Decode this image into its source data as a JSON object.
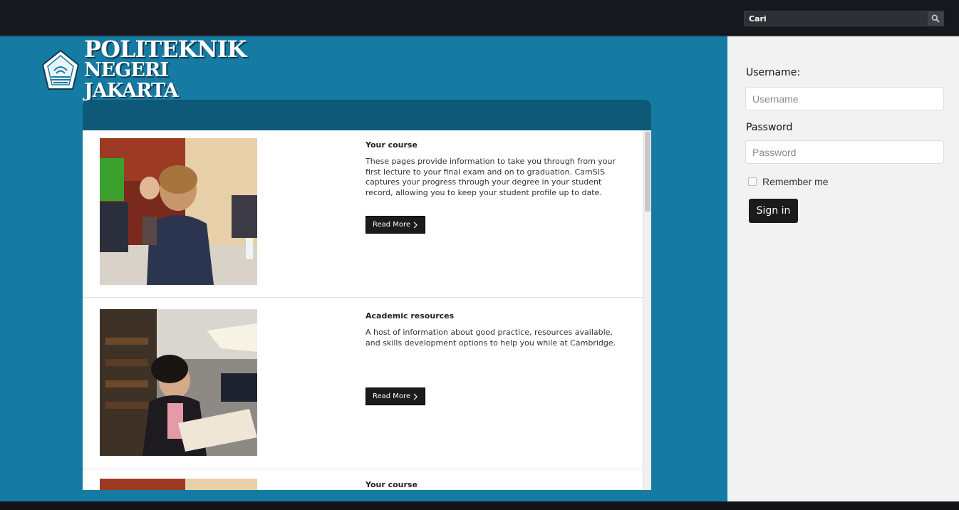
{
  "search": {
    "placeholder": "Cari",
    "icon": "search-icon"
  },
  "logo": {
    "line1": "POLITEKNIK",
    "line2": "NEGERI JAKARTA"
  },
  "items": [
    {
      "title": "Your course",
      "description": "These pages provide information to take you through from your first lecture to your final exam and on to graduation. CamSIS captures your progress through your degree in your student record, allowing you to keep your student profile up to date.",
      "button": "Read More"
    },
    {
      "title": "Academic resources",
      "description": "A host of information about good practice, resources available, and skills development options to help you while at Cambridge.",
      "button": "Read More"
    },
    {
      "title": "Your course"
    }
  ],
  "login": {
    "username_label": "Username:",
    "username_placeholder": "Username",
    "password_label": "Password",
    "password_placeholder": "Password",
    "remember_label": "Remember me",
    "signin_label": "Sign in"
  },
  "colors": {
    "topbar": "#15181c",
    "main_bg": "#157ba3",
    "panel_header": "#0e5878",
    "sidebar_bg": "#f2f2f2",
    "button_dark": "#1b1b1b"
  }
}
